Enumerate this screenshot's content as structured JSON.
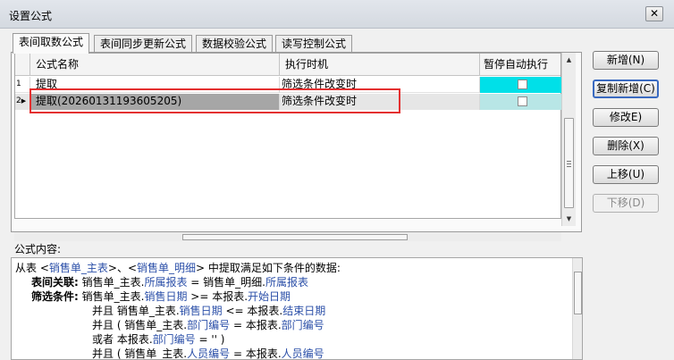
{
  "window": {
    "title": "设置公式",
    "close_label": "✕"
  },
  "tabs": [
    {
      "label": "表间取数公式",
      "active": true
    },
    {
      "label": "表间同步更新公式",
      "active": false
    },
    {
      "label": "数据校验公式",
      "active": false
    },
    {
      "label": "读写控制公式",
      "active": false
    }
  ],
  "grid": {
    "columns": [
      "公式名称",
      "执行时机",
      "暂停自动执行"
    ],
    "rows": [
      {
        "num": "1",
        "name": "提取",
        "time": "筛选条件改变时",
        "paused": false,
        "selected": false
      },
      {
        "num": "2",
        "marker": "▶",
        "name": "提取(20260131193605205)",
        "time": "筛选条件改变时",
        "paused": false,
        "selected": true
      }
    ]
  },
  "buttons": {
    "new": "新增(N)",
    "copy_new": "复制新增(C)",
    "edit": "修改E)",
    "delete": "删除(X)",
    "move_up": "上移(U)",
    "move_down": "下移(D)"
  },
  "content": {
    "label": "公式内容:",
    "line1": {
      "a": "从表 ",
      "b": "<",
      "c": "销售单_主表",
      "d": ">、<",
      "e": "销售单_明细",
      "f": "> 中提取满足如下条件的数据:"
    },
    "line2": {
      "kw": "表间关联:",
      "a": " 销售单_主表.",
      "b": "所属报表",
      "c": " = 销售单_明细.",
      "d": "所属报表"
    },
    "line3": {
      "kw": "筛选条件:",
      "a": " 销售单_主表.",
      "b": "销售日期",
      "c": " >= 本报表.",
      "d": "开始日期"
    },
    "line4": {
      "a": "并且 销售单_主表.",
      "b": "销售日期",
      "c": " <= 本报表.",
      "d": "结束日期"
    },
    "line5": {
      "a": "并且 ( 销售单_主表.",
      "b": "部门编号",
      "c": " = 本报表.",
      "d": "部门编号"
    },
    "line6": {
      "a": "或者 本报表.",
      "b": "部门编号",
      "c": " = '' )"
    },
    "line7": {
      "a": "并且 ( 销售单_主表.",
      "b": "人员编号",
      "c": " = 本报表.",
      "d": "人员编号"
    }
  },
  "colors": {
    "selected_row": "#a6a6a6",
    "paused_cell": "#00e0e8",
    "highlight_border": "#e43030",
    "field_text": "#2b4fa8"
  }
}
